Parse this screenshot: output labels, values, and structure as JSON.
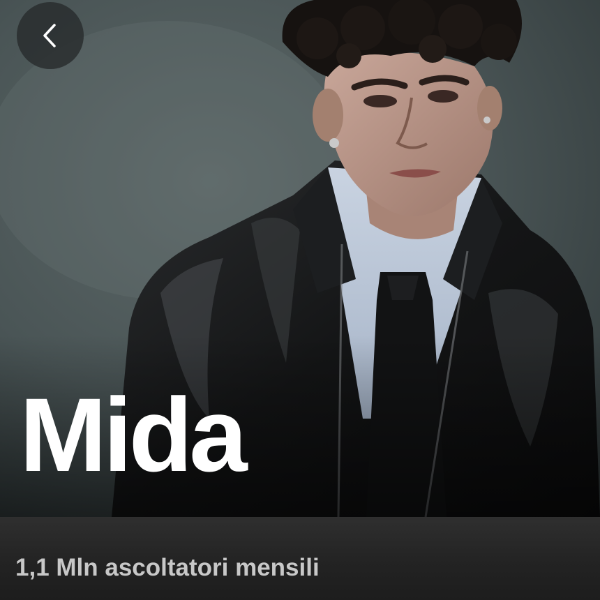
{
  "header": {
    "back_icon": "chevron-left-icon"
  },
  "artist": {
    "name": "Mida",
    "monthly_listeners": "1,1 Mln ascoltatori mensili"
  },
  "colors": {
    "background": "#121212",
    "info_panel": "#2a2a2a",
    "name_text": "#ffffff",
    "listeners_text": "#c8c8c8"
  }
}
